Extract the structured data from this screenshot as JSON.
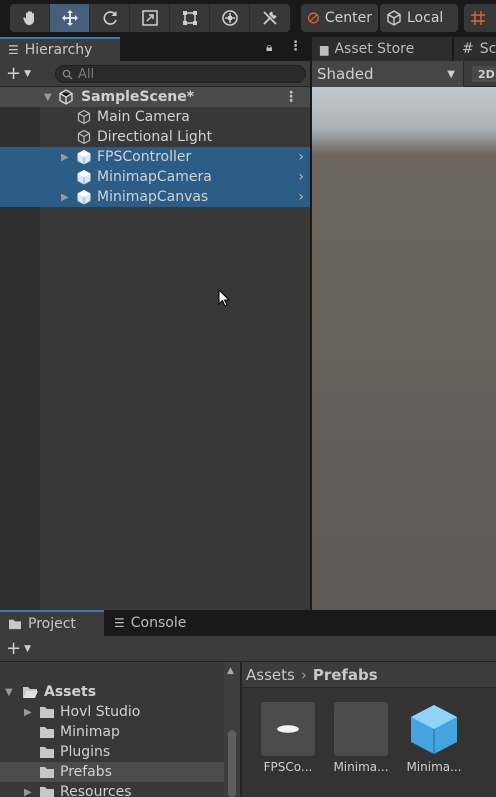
{
  "toolbar": {
    "tools": [
      {
        "icon": "hand-tool-icon"
      },
      {
        "icon": "move-tool-icon",
        "active": true
      },
      {
        "icon": "rotate-tool-icon"
      },
      {
        "icon": "scale-tool-icon"
      },
      {
        "icon": "rect-tool-icon"
      },
      {
        "icon": "transform-tool-icon"
      },
      {
        "icon": "custom-tool-icon"
      }
    ],
    "pivot_mode": "Center",
    "pivot_rotation": "Local"
  },
  "hierarchy": {
    "tab_label": "Hierarchy",
    "search_placeholder": "All",
    "scene_name": "SampleScene*",
    "items": [
      {
        "label": "Main Camera",
        "icon": "gameobject-icon",
        "selected": false
      },
      {
        "label": "Directional Light",
        "icon": "gameobject-icon",
        "selected": false
      },
      {
        "label": "FPSController",
        "icon": "prefab-icon",
        "selected": true
      },
      {
        "label": "MinimapCamera",
        "icon": "prefab-icon",
        "selected": true
      },
      {
        "label": "MinimapCanvas",
        "icon": "prefab-icon",
        "selected": true
      }
    ]
  },
  "scene": {
    "tabs": [
      "Asset Store",
      "Sc"
    ],
    "shading_mode": "Shaded",
    "mode_2d": "2D"
  },
  "project": {
    "tabs": [
      "Project",
      "Console"
    ],
    "tree": [
      {
        "label": "Assets",
        "expanded": true
      },
      {
        "label": "Hovl Studio"
      },
      {
        "label": "Minimap"
      },
      {
        "label": "Plugins"
      },
      {
        "label": "Prefabs",
        "selected": true
      },
      {
        "label": "Resources"
      }
    ],
    "breadcrumb": [
      "Assets",
      "Prefabs"
    ],
    "assets": [
      "FPSCo...",
      "Minima...",
      "Minima..."
    ]
  },
  "colors": {
    "accent_blue": "#3a79bb",
    "selection": "#2c5d87",
    "prefab_blue": "#5ab4ec"
  }
}
